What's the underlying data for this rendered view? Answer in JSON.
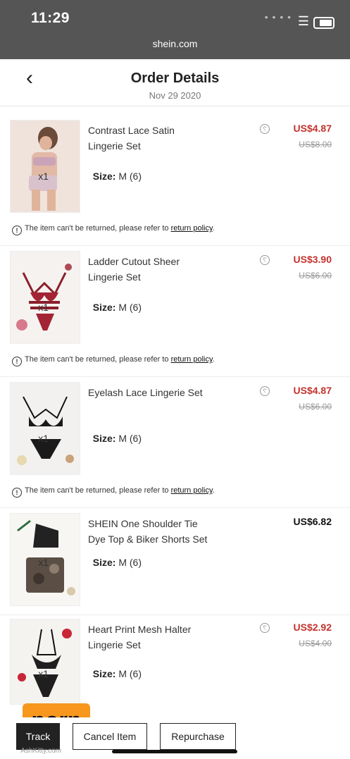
{
  "status_bar": {
    "time": "11:29",
    "url": "shein.com"
  },
  "header": {
    "title": "Order Details",
    "date": "Nov 29 2020"
  },
  "notice": {
    "text_prefix": "The item can't be returned, please refer to",
    "link_text": "return policy",
    "suffix": "."
  },
  "items": [
    {
      "name": "Contrast Lace Satin Lingerie Set",
      "price": "US$4.87",
      "old_price": "US$8.00",
      "size": "M (6)",
      "qty": "x1",
      "price_color": "#c3322d"
    },
    {
      "name": "Ladder Cutout Sheer Lingerie Set",
      "price": "US$3.90",
      "old_price": "US$6.00",
      "size": "M (6)",
      "qty": "x1",
      "price_color": "#c3322d"
    },
    {
      "name": "Eyelash Lace Lingerie Set",
      "price": "US$4.87",
      "old_price": "US$6.00",
      "size": "M (6)",
      "qty": "x1",
      "price_color": "#c3322d"
    },
    {
      "name": "SHEIN One Shoulder Tie Dye Top & Biker Shorts Set",
      "price": "US$6.82",
      "size": "M (6)",
      "qty": "x1",
      "price_color": "#111111"
    },
    {
      "name": "Heart Print Mesh Halter Lingerie Set",
      "price": "US$2.92",
      "old_price": "US$4.00",
      "size": "M (6)",
      "qty": "x1",
      "price_color": "#c3322d"
    }
  ],
  "size_label": "Size:",
  "buttons": {
    "repurchase": "Repurchase",
    "cancel": "Cancel Item",
    "track": "Track"
  },
  "watermark": {
    "text": "porn",
    "small": "AshKitty.com"
  }
}
